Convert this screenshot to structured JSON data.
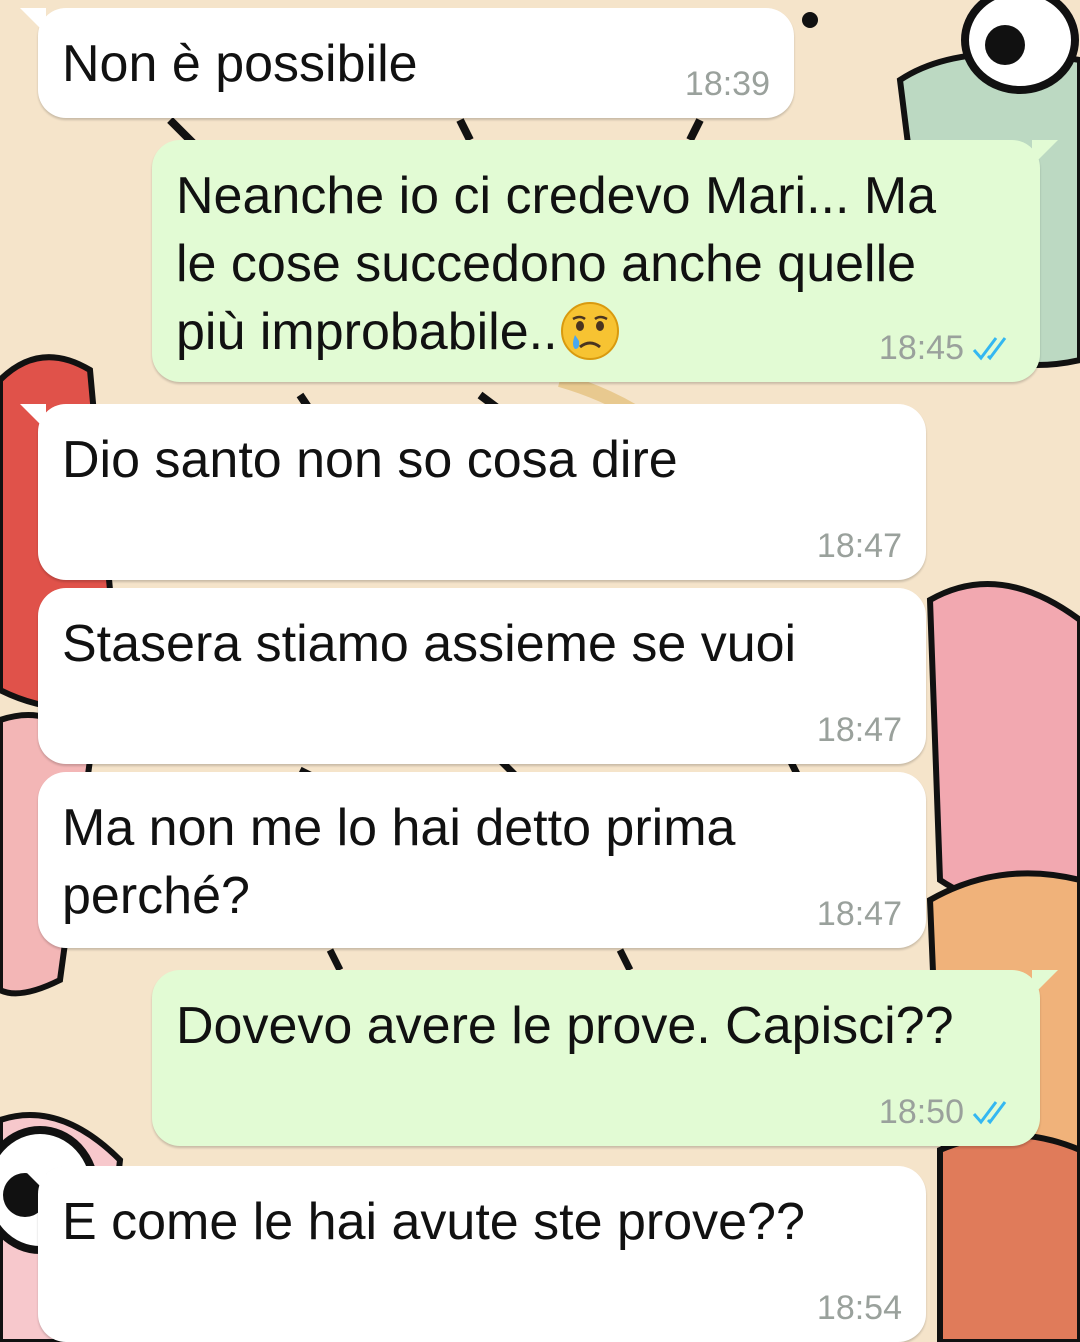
{
  "messages": [
    {
      "direction": "incoming",
      "text": "Non è possibile",
      "time": "18:39"
    },
    {
      "direction": "outgoing",
      "text": "Neanche io ci credevo Mari... Ma\nle cose succedono anche quelle\npiù improbabile..",
      "emoji": "crying-face",
      "time": "18:45",
      "status": "read"
    },
    {
      "direction": "incoming",
      "text": "Dio santo non so cosa dire",
      "time": "18:47"
    },
    {
      "direction": "incoming",
      "text": "Stasera stiamo assieme se vuoi",
      "time": "18:47"
    },
    {
      "direction": "incoming",
      "text": "Ma non me lo hai detto prima\nperché?",
      "time": "18:47"
    },
    {
      "direction": "outgoing",
      "text": "Dovevo avere le prove. Capisci??",
      "time": "18:50",
      "status": "read"
    },
    {
      "direction": "incoming",
      "text": "E come le hai avute ste prove??",
      "time": "18:54"
    }
  ],
  "colors": {
    "incoming_bubble": "#ffffff",
    "outgoing_bubble": "#e2fbd4",
    "read_ticks": "#34b7f1",
    "timestamp": "#9aa19c"
  }
}
